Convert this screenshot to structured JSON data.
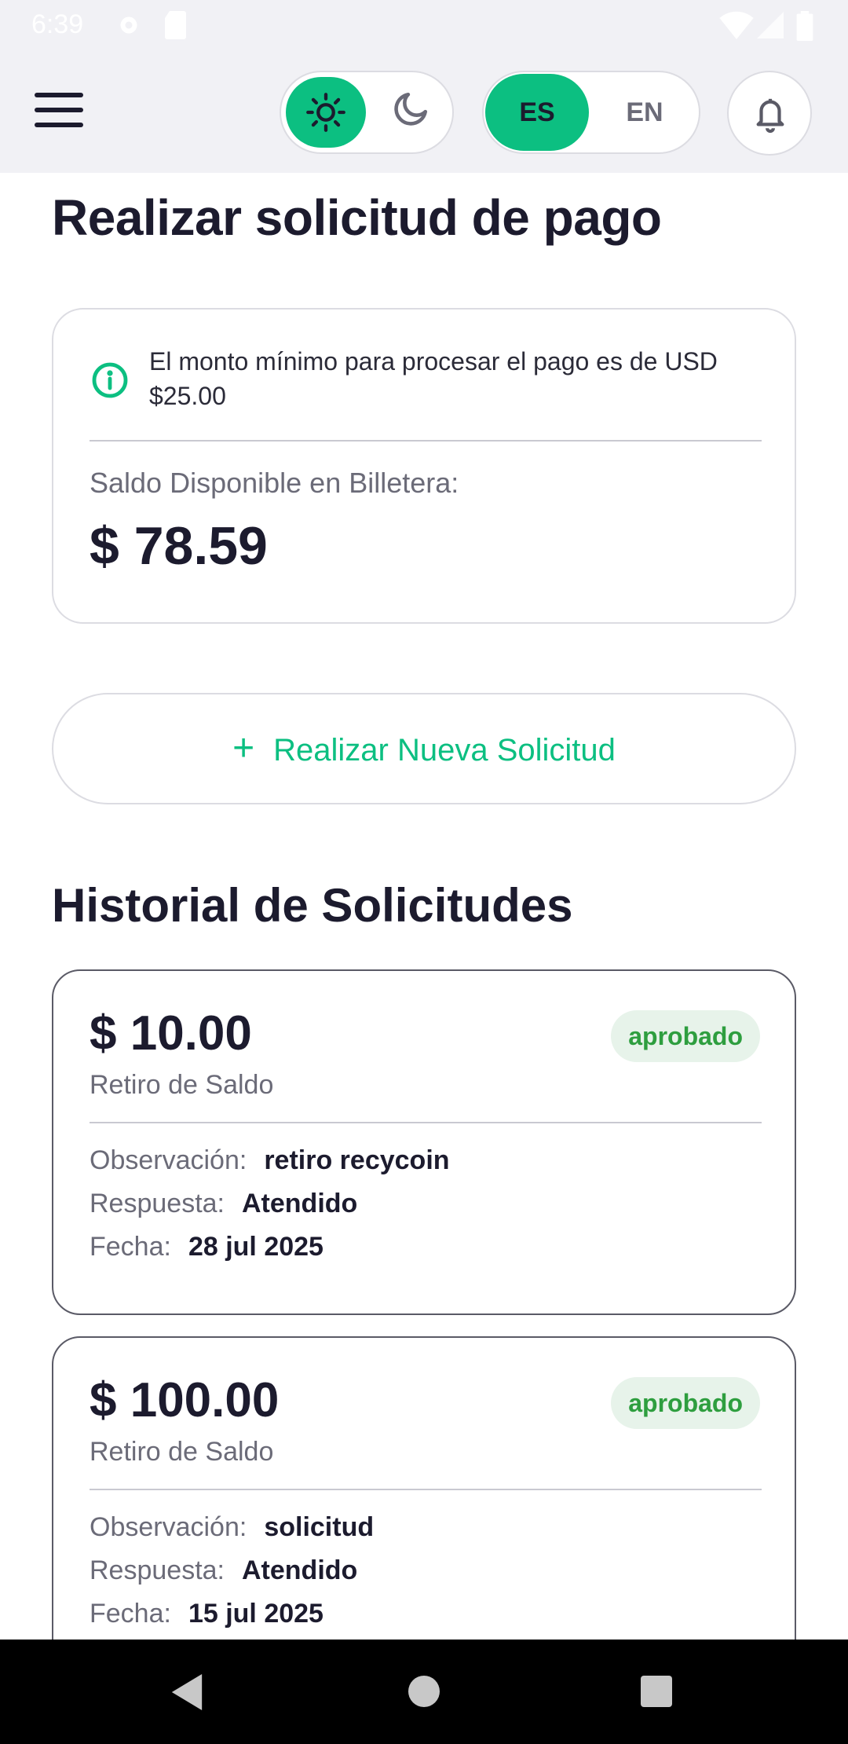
{
  "status_bar": {
    "time": "6:39"
  },
  "header": {
    "lang_es": "ES",
    "lang_en": "EN",
    "theme_selected": "light",
    "lang_selected": "ES",
    "colors": {
      "accent": "#0cbf81",
      "header_bg": "#f1f1f5"
    }
  },
  "page": {
    "title": "Realizar solicitud de pago",
    "info_text": "El monto mínimo para procesar el pago es de USD $25.00",
    "balance_label": "Saldo Disponible en Billetera:",
    "balance_value": "$ 78.59",
    "new_request_plus": "+",
    "new_request_label": "Realizar Nueva Solicitud",
    "history_title": "Historial de Solicitudes"
  },
  "history": [
    {
      "amount": "$ 10.00",
      "type": "Retiro de Saldo",
      "status": "aprobado",
      "obs_label": "Observación:",
      "obs_value": "retiro recycoin",
      "resp_label": "Respuesta:",
      "resp_value": "Atendido",
      "date_label": "Fecha:",
      "date_value": "28 jul 2025"
    },
    {
      "amount": "$ 100.00",
      "type": "Retiro de Saldo",
      "status": "aprobado",
      "obs_label": "Observación:",
      "obs_value": "solicitud",
      "resp_label": "Respuesta:",
      "resp_value": "Atendido",
      "date_label": "Fecha:",
      "date_value": "15 jul 2025"
    }
  ],
  "icons": {
    "menu": "hamburger-icon",
    "light": "sun-icon",
    "dark": "moon-icon",
    "notifications": "bell-icon",
    "info": "info-icon",
    "add": "plus-icon"
  }
}
